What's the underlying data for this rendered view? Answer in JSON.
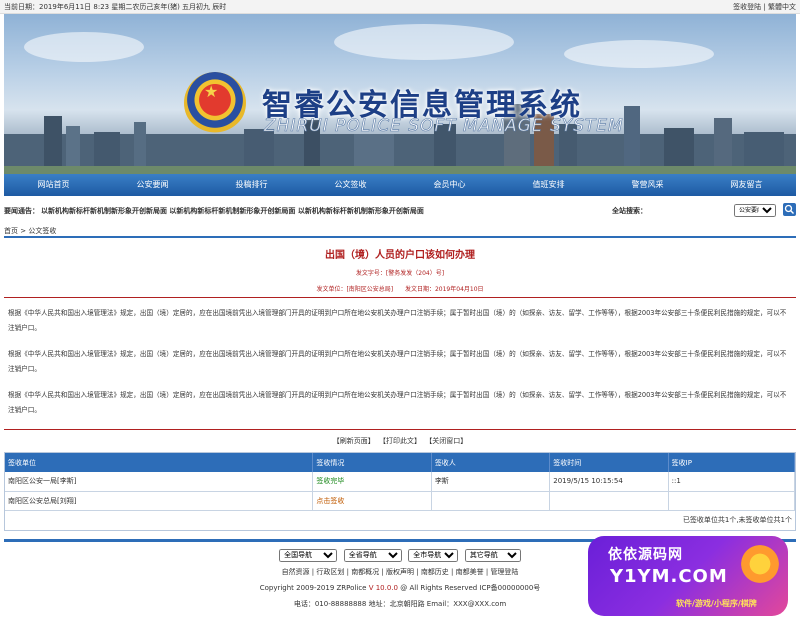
{
  "topbar": {
    "date": "当前日期：2019年6月11日 8:23 星期二农历己亥年(猪) 五月初九 辰时",
    "links": [
      "签收登陆",
      "繁體中文"
    ],
    "separator": "|"
  },
  "banner": {
    "title_cn": "智睿公安信息管理系统",
    "title_en": "ZHIRUI POLICE SOFT MANAGE SYSTEM"
  },
  "nav": [
    "网站首页",
    "公安要闻",
    "投稿排行",
    "公文签收",
    "会员中心",
    "值班安排",
    "警营风采",
    "网友留言"
  ],
  "notice": {
    "label": "要闻通告：",
    "items": "以新机构新标杆新机制新形象开创新局面  以新机构新标杆新机制新形象开创新局面  以新机构新标杆新机制新形象开创新局面",
    "search_label": "全站搜索：",
    "search_select": "公安要闻"
  },
  "breadcrumb": "首页 > 公文签收",
  "article": {
    "title": "出国（境）人员的户口该如何办理",
    "doc_no": "发文字号：[警务发发（204）号]",
    "issuer": "发文单位：[南阳区公安总局]",
    "date": "发文日期：2019年04月10日",
    "paragraphs": [
      "根据《中华人民共和国出入境管理法》规定，出国（境）定居的，应在出国境前凭出入境管理部门开具的证明到户口所在地公安机关办理户口注销手续；属于暂时出国（境）的（如探亲、访友、留学、工作等等），根据2003年公安部三十条便民利民措施的规定，可以不注销户口。",
      "根据《中华人民共和国出入境管理法》规定，出国（境）定居的，应在出国境前凭出入境管理部门开具的证明到户口所在地公安机关办理户口注销手续；属于暂时出国（境）的（如探亲、访友、留学、工作等等），根据2003年公安部三十条便民利民措施的规定，可以不注销户口。",
      "根据《中华人民共和国出入境管理法》规定，出国（境）定居的，应在出国境前凭出入境管理部门开具的证明到户口所在地公安机关办理户口注销手续；属于暂时出国（境）的（如探亲、访友、留学、工作等等），根据2003年公安部三十条便民利民措施的规定，可以不注销户口。"
    ]
  },
  "actions": [
    "【刷新页面】",
    "【打印此文】",
    "【关闭窗口】"
  ],
  "sign_table": {
    "headers": [
      "签收单位",
      "签收情况",
      "签收人",
      "签收时间",
      "签收IP"
    ],
    "rows": [
      [
        "南阳区公安一局[李斯]",
        "签收完毕",
        "李斯",
        "2019/5/15 10:15:54",
        "::1"
      ],
      [
        "南阳区公安总局[刘翔]",
        "点击签收",
        "",
        "",
        ""
      ]
    ],
    "footer": "已签收单位共1个,未签收单位共1个"
  },
  "footer": {
    "selects": [
      "全国导航",
      "全省导航",
      "全市导航",
      "其它导航"
    ],
    "links": [
      "自然资源",
      "行政区划",
      "南都概况",
      "版权声明",
      "南都历史",
      "南都美誉",
      "管理登陆"
    ],
    "copyright_pre": "Copyright 2009-2019 ZRPolice",
    "version": "V 10.0.0",
    "copyright_post": "@ All Rights Reserved ICP备00000000号",
    "contact": "电话：010-88888888    地址：北京朝阳路 Email：XXX@XXX.com"
  },
  "watermark": {
    "line1": "依依源码网",
    "line2": "Y1YM.COM",
    "line3": "软件/游戏/小程序/棋牌"
  },
  "colors": {
    "primary": "#2d6db8",
    "accent_red": "#b02020",
    "status_done": "#1e8a1e",
    "status_todo": "#c05a00"
  }
}
